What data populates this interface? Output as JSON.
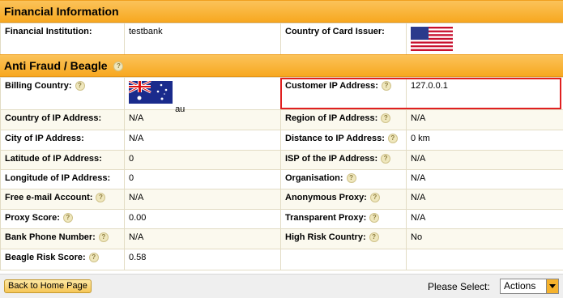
{
  "financial": {
    "title": "Financial Information",
    "institution_label": "Financial Institution:",
    "institution_value": "testbank",
    "country_issuer_label": "Country of Card Issuer:",
    "country_issuer_flag": "us-flag-icon"
  },
  "antifraud": {
    "title": "Anti Fraud / Beagle",
    "billing_country_label": "Billing Country:",
    "billing_country_code": "au",
    "billing_country_flag": "au-flag-icon",
    "customer_ip_label": "Customer IP Address:",
    "customer_ip_value": "127.0.0.1",
    "rows": [
      {
        "left_label": "Country of IP Address:",
        "left_help": false,
        "left_value": "N/A",
        "right_label": "Region of IP Address:",
        "right_help": true,
        "right_value": "N/A"
      },
      {
        "left_label": "City of IP Address:",
        "left_help": false,
        "left_value": "N/A",
        "right_label": "Distance to IP Address:",
        "right_help": true,
        "right_value": "0 km"
      },
      {
        "left_label": "Latitude of IP Address:",
        "left_help": false,
        "left_value": "0",
        "right_label": "ISP of the IP Address:",
        "right_help": true,
        "right_value": "N/A"
      },
      {
        "left_label": "Longitude of IP Address:",
        "left_help": false,
        "left_value": "0",
        "right_label": "Organisation:",
        "right_help": true,
        "right_value": "N/A"
      },
      {
        "left_label": "Free e-mail Account:",
        "left_help": true,
        "left_value": "N/A",
        "right_label": "Anonymous Proxy:",
        "right_help": true,
        "right_value": "N/A"
      },
      {
        "left_label": "Proxy Score:",
        "left_help": true,
        "left_value": "0.00",
        "right_label": "Transparent Proxy:",
        "right_help": true,
        "right_value": "N/A"
      },
      {
        "left_label": "Bank Phone Number:",
        "left_help": true,
        "left_value": "N/A",
        "right_label": "High Risk Country:",
        "right_help": true,
        "right_value": "No"
      },
      {
        "left_label": "Beagle Risk Score:",
        "left_help": true,
        "left_value": "0.58",
        "right_label": "",
        "right_help": false,
        "right_value": ""
      }
    ]
  },
  "footer": {
    "home_button": "Back to Home Page",
    "please_select_label": "Please Select:",
    "actions_selected": "Actions"
  },
  "colors": {
    "header_orange": "#f7a820",
    "row_alt": "#fbf9ee",
    "highlight_red": "#e02020"
  },
  "help_icon_glyph": "?"
}
